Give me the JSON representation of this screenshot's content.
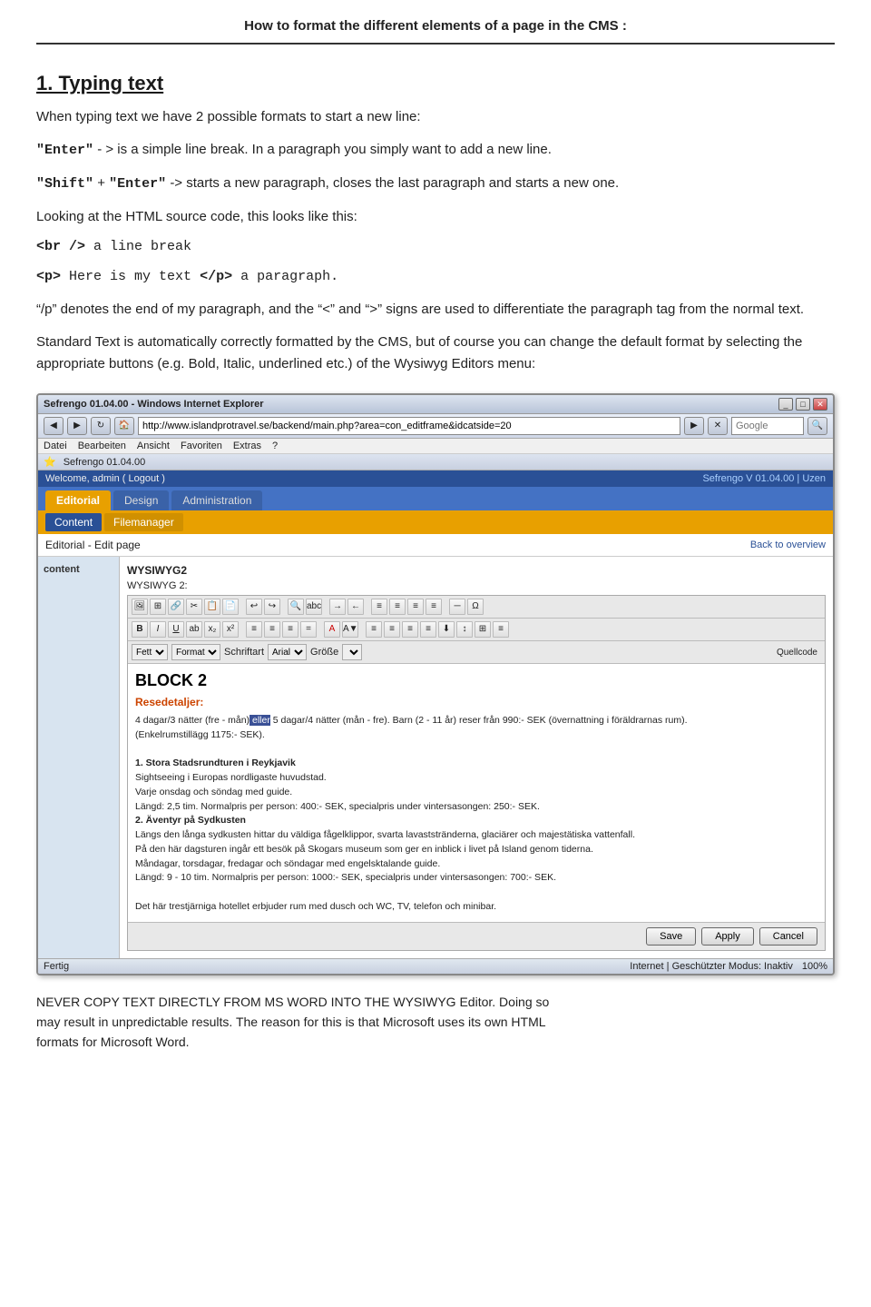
{
  "page": {
    "title": "How to format the different elements of a page in the CMS :",
    "section1_heading": "1. Typing text",
    "para1": "When typing text we have 2 possible formats to start a new line:",
    "enter_label": "“Enter”",
    "enter_desc": " - > is a simple line break. In a paragraph you simply want to add a new line.",
    "shift_label": "“Shift”",
    "shift_plus": " + ",
    "enter2_label": "“Enter”",
    "shift_desc": " -> starts a new paragraph, closes the last paragraph and starts a new one.",
    "para2": "Looking at the HTML source code, this looks like this:",
    "code_br": "<br />",
    "code_br_desc": " a line break",
    "code_p_open": "<p>",
    "code_p_text": "  Here is my text ",
    "code_p_close": "</p>",
    "code_p_desc": "  a paragraph.",
    "para3": "“/p” denotes the end of my paragraph, and the “<” and “>” signs are used to differentiate the paragraph tag from the normal text.",
    "para4": "Standard Text is automatically correctly formatted by the CMS, but of course you can change the default format by selecting the appropriate buttons (e.g. Bold, Italic, underlined etc.) of the Wysiwyg Editors menu:",
    "warning_line1": "NEVER COPY TEXT DIRECTLY FROM MS WORD INTO THE WYSIWYG Editor. Doing so",
    "warning_line2": "may result in unpredictable results. The reason for this is that Microsoft uses its own HTML",
    "warning_line3": "formats for Microsoft Word."
  },
  "browser": {
    "title": "Sefrengo 01.04.00 - Windows Internet Explorer",
    "url": "http://www.islandprotravel.se/backend/main.php?area=con_editframe&idcatside=20",
    "search_placeholder": "Google",
    "menu_items": [
      "Datei",
      "Bearbeiten",
      "Ansicht",
      "Favoriten",
      "Extras",
      "?"
    ],
    "fav_label": "Sefrengo 01.04.00",
    "status_left": "Fertig",
    "status_right": "Internet | Geschützter Modus: Inaktiv",
    "zoom": "100%"
  },
  "cms": {
    "welcome": "Welcome, admin ( Logout )",
    "version": "Sefrengo V 01.04.00 | Uzen",
    "main_tabs": [
      "Editorial",
      "Design",
      "Administration"
    ],
    "active_main_tab": "Editorial",
    "sub_tabs": [
      "Content",
      "Filemanager"
    ],
    "active_sub_tab": "Content",
    "breadcrumb": "Editorial - Edit page",
    "back_link": "Back to overview",
    "sidebar_label": "content",
    "wysiwyg_title": "WYSIWYG2",
    "wysiwyg_subtitle": "WYSIWYG 2:",
    "toolbar_buttons": [
      "B",
      "I",
      "U",
      "ab",
      "x₂",
      "x²",
      "|",
      "☰",
      "☰",
      "☰",
      "=",
      "|",
      "A",
      "A▼",
      "|",
      "═",
      "═",
      "═",
      "═",
      "═",
      "═"
    ],
    "format_label": "Fett",
    "format_select": "Format",
    "schriftart_label": "Schriftart",
    "font_select": "Arial",
    "groesse_label": "Größe",
    "quellcode_btn": "Quellcode",
    "heading_text": "BLOCK 2",
    "cms_content": {
      "resedetaljer": "Resedetaljer:",
      "text1": "4 dagar/3 nätter (fre - mån)",
      "highlighted": "eller",
      "text2": "5 dagar/4 nätter (mån - fre). Barn (2 - 11 år) reser från 990:- SEK (övernattning i föräldrarnas rum).",
      "text3": "(Enkelrumstillägg 1175:- SEK).",
      "section1_title": "1. Stora Stadsrundturen i Reykjavik",
      "section1_text": "Sightseeing i Europas nordligaste huvudstad.\nVarje onsdag och söndag med guide.\nLängd: 2,5 tim. Normalpris per person: 400:- SEK, specialpris under vintersasongen: 250:- SEK.",
      "section2_title": "2. Äventyr på Sydkusten",
      "section2_text": "Längs den långa sydkusten hittar du väldiga fågelklippor, svarta lavaststränder, glaciärer och majestätiska vattenfall.\nPå den här dagsturen ingår ett besök på Skogars museum som ger en inblick i livet på Island genom tiderna.\nMåndagar, torsdagar, fredagar och söndagar med engelsktalande guide.\nLängd: 9 - 10 tim. Normalpris per person: 1000:- SEK, specialpris under vintersasongen: 700:- SEK.",
      "section3_text": "Det här trestjärniga hotellet erbjuder rum med dusch och WC, TV, telefon och minibar."
    },
    "action_buttons": [
      "Save",
      "Apply",
      "Cancel"
    ]
  }
}
